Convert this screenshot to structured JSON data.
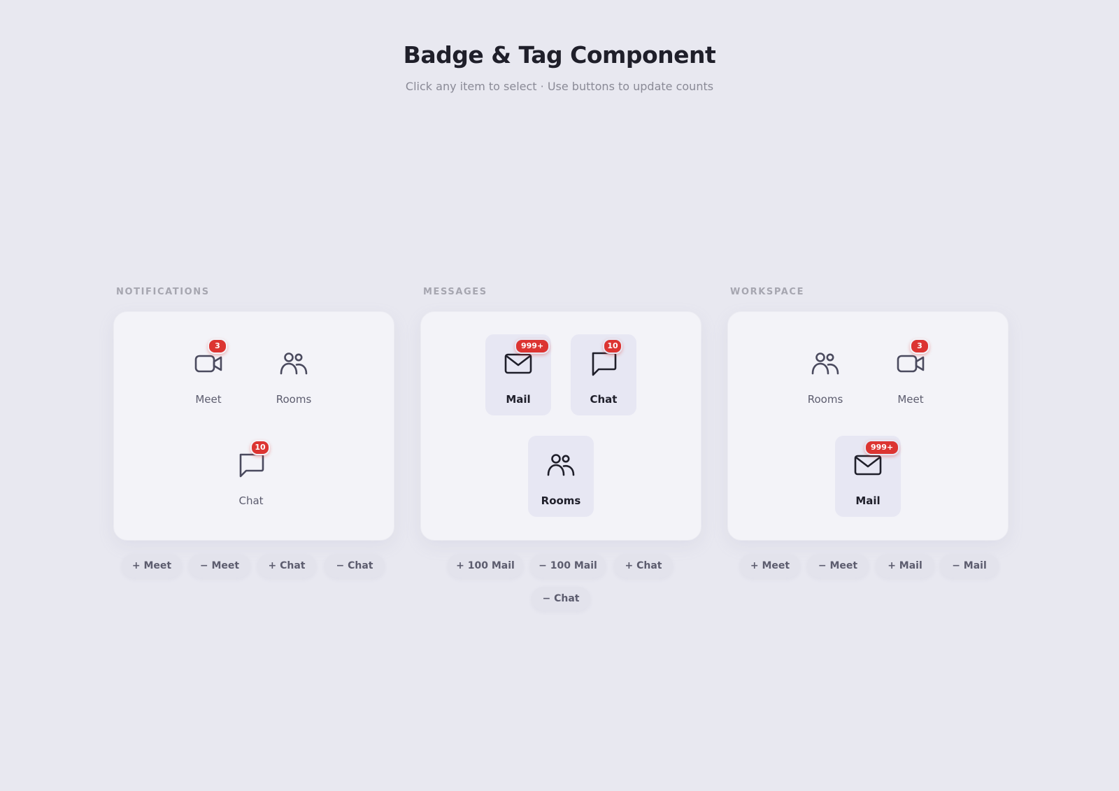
{
  "header": {
    "title": "Badge & Tag Component",
    "subtitle": "Click any item to select · Use buttons to update counts"
  },
  "colors": {
    "background": "#e8e8f0",
    "card": "#f3f3f8",
    "selected_item": "#e7e7f3",
    "badge": "#dc3431",
    "icon_stroke": "#4a4a5e",
    "icon_stroke_selected": "#1f1f2a"
  },
  "sections": [
    {
      "label": "NOTIFICATIONS",
      "items": [
        {
          "icon": "video-camera-icon",
          "label": "Meet",
          "badge": "3",
          "selected": false
        },
        {
          "icon": "people-icon",
          "label": "Rooms",
          "badge": null,
          "selected": false
        },
        {
          "icon": "chat-bubble-icon",
          "label": "Chat",
          "badge": "10",
          "selected": false
        }
      ],
      "buttons": [
        "+ Meet",
        "− Meet",
        "+ Chat",
        "− Chat"
      ]
    },
    {
      "label": "MESSAGES",
      "items": [
        {
          "icon": "mail-icon",
          "label": "Mail",
          "badge": "999+",
          "selected": true
        },
        {
          "icon": "chat-bubble-icon",
          "label": "Chat",
          "badge": "10",
          "selected": true
        },
        {
          "icon": "people-icon",
          "label": "Rooms",
          "badge": null,
          "selected": true
        }
      ],
      "buttons": [
        "+ 100 Mail",
        "− 100 Mail",
        "+ Chat",
        "− Chat"
      ]
    },
    {
      "label": "WORKSPACE",
      "items": [
        {
          "icon": "people-icon",
          "label": "Rooms",
          "badge": null,
          "selected": false
        },
        {
          "icon": "video-camera-icon",
          "label": "Meet",
          "badge": "3",
          "selected": false
        },
        {
          "icon": "mail-icon",
          "label": "Mail",
          "badge": "999+",
          "selected": true
        }
      ],
      "buttons": [
        "+ Meet",
        "− Meet",
        "+ Mail",
        "− Mail"
      ]
    }
  ]
}
